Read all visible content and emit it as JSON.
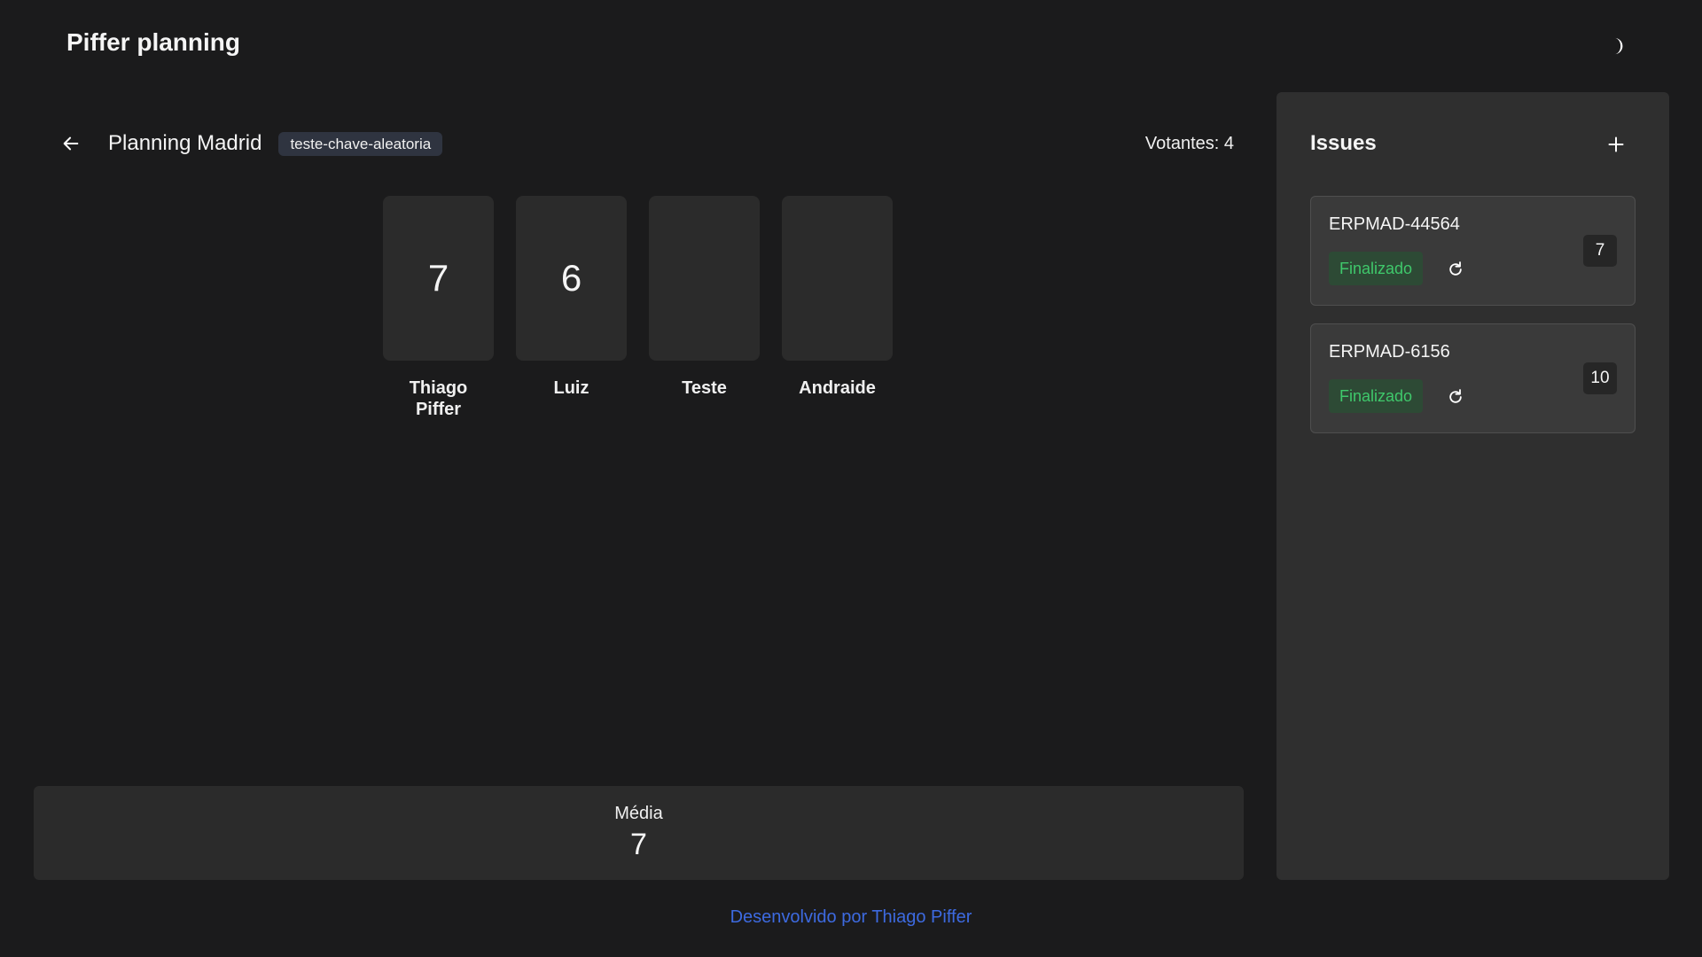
{
  "app": {
    "title": "Piffer planning",
    "theme_icon": "moon-icon"
  },
  "room": {
    "name": "Planning Madrid",
    "key": "teste-chave-aleatoria",
    "voters_label": "Votantes: 4"
  },
  "votes": [
    {
      "name": "Thiago Piffer",
      "value": "7"
    },
    {
      "name": "Luiz",
      "value": "6"
    },
    {
      "name": "Teste",
      "value": ""
    },
    {
      "name": "Andraide",
      "value": ""
    }
  ],
  "average": {
    "label": "Média",
    "value": "7"
  },
  "footer": {
    "link_text": "Desenvolvido por Thiago Piffer"
  },
  "issues": {
    "title": "Issues",
    "items": [
      {
        "key": "ERPMAD-44564",
        "status": "Finalizado",
        "score": "7"
      },
      {
        "key": "ERPMAD-6156",
        "status": "Finalizado",
        "score": "10"
      }
    ]
  },
  "colors": {
    "background": "#1b1b1c",
    "panel": "#2f2f2f",
    "card": "#2b2b2b",
    "status_green": "#3fc86b",
    "link_blue": "#3d6ae0"
  }
}
